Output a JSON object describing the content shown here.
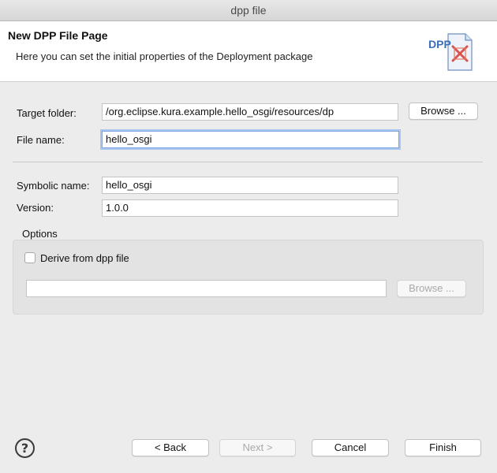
{
  "window": {
    "title": "dpp file"
  },
  "header": {
    "title": "New DPP File Page",
    "description": "Here you can set the initial properties of the Deployment package",
    "icon": "dpp-file-icon",
    "icon_text": "DPP"
  },
  "form": {
    "target_folder_label": "Target folder:",
    "target_folder_value": "/org.eclipse.kura.example.hello_osgi/resources/dp",
    "browse_label": "Browse ...",
    "file_name_label": "File name:",
    "file_name_value": "hello_osgi",
    "symbolic_name_label": "Symbolic name:",
    "symbolic_name_value": "hello_osgi",
    "version_label": "Version:",
    "version_value": "1.0.0"
  },
  "options": {
    "title": "Options",
    "derive_label": "Derive from dpp file",
    "derive_checked": false,
    "derive_path_value": "",
    "browse_label": "Browse ..."
  },
  "footer": {
    "back_label": "< Back",
    "next_label": "Next >",
    "cancel_label": "Cancel",
    "finish_label": "Finish"
  },
  "colors": {
    "focus_ring": "#a8c6ef",
    "icon_blue": "#3b6fb6",
    "icon_red": "#d9534f"
  }
}
